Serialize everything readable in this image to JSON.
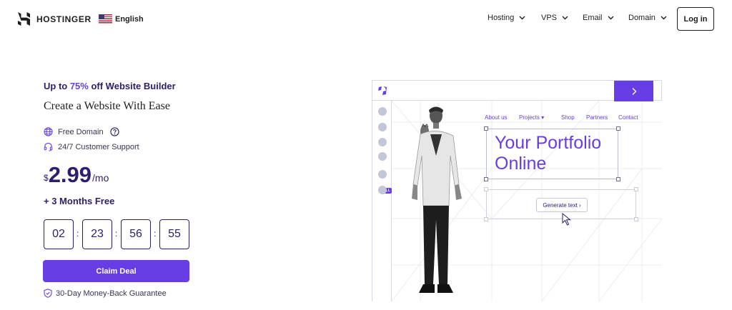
{
  "header": {
    "logo_text": "HOSTINGER",
    "language": "English",
    "nav": [
      {
        "label": "Hosting"
      },
      {
        "label": "VPS"
      },
      {
        "label": "Email"
      },
      {
        "label": "Domain"
      }
    ],
    "login_label": "Log in"
  },
  "promo": {
    "title_prefix": "Up to ",
    "title_discount": "75%",
    "title_suffix": " off Website Builder",
    "subtitle": "Create a Website With Ease",
    "features": [
      "Free Domain",
      "24/7 Customer Support"
    ],
    "price": {
      "currency": "$",
      "amount": "2.99",
      "period": "/mo"
    },
    "bonus": "+ 3 Months Free",
    "countdown": [
      "02",
      "23",
      "56",
      "55"
    ],
    "cta_label": "Claim Deal",
    "guarantee": "30-Day Money-Back Guarantee"
  },
  "mockup": {
    "nav": [
      "About us",
      "Projects ▾",
      "Shop",
      "Partners",
      "Contact"
    ],
    "headline_line1": "Your Portfolio",
    "headline_line2": "Online",
    "generate_label": "Generate text",
    "sell_badge": "SELL"
  },
  "colors": {
    "brand_purple": "#673de6",
    "dark_navy": "#2f1c6a"
  },
  "icons": [
    "hostinger-logo-icon",
    "us-flag-icon",
    "chevron-down-icon",
    "globe-icon",
    "help-circle-icon",
    "headset-icon",
    "shield-check-icon",
    "arrow-right-icon",
    "cursor-arrow-icon"
  ]
}
